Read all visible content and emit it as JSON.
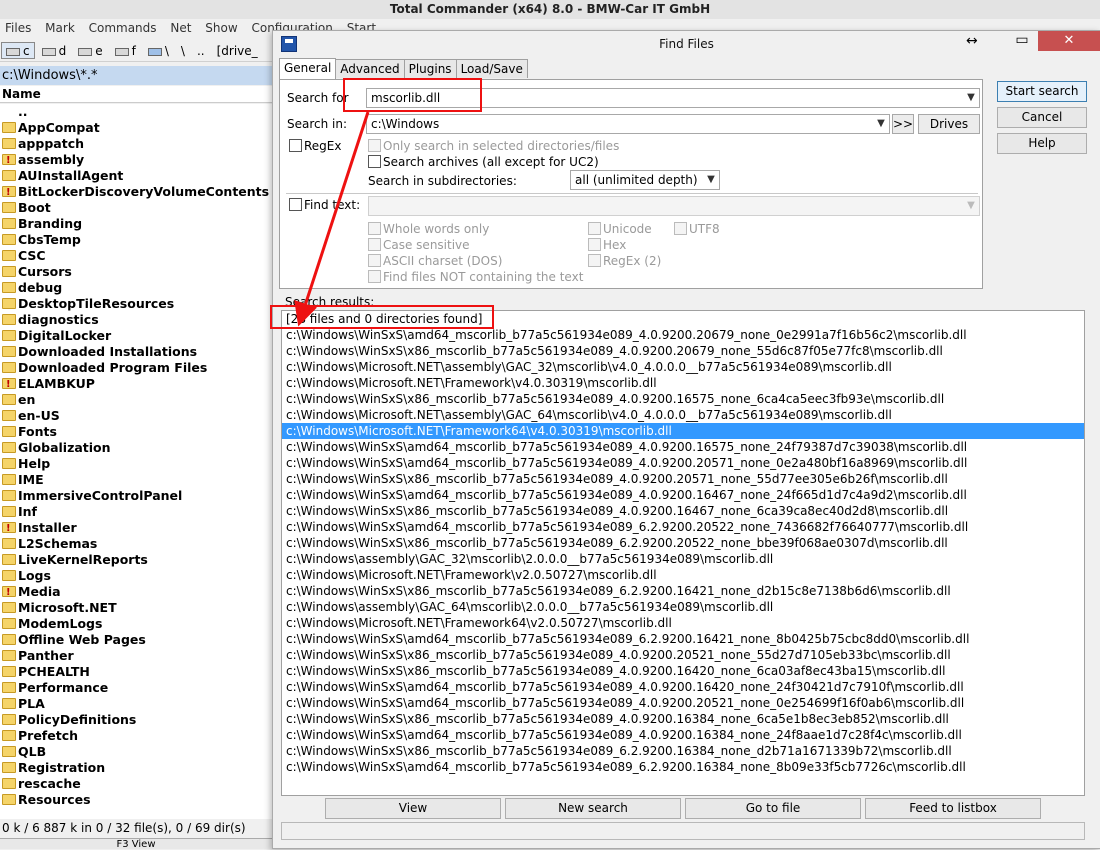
{
  "app": {
    "title": "Total Commander (x64) 8.0 - BMW-Car IT GmbH",
    "menu": [
      "Files",
      "Mark",
      "Commands",
      "Net",
      "Show",
      "Configuration",
      "Start"
    ],
    "drives": [
      "c",
      "d",
      "e",
      "f"
    ],
    "drive_extra": [
      "\\",
      "\\",
      "..",
      "[drive_"
    ],
    "current_path": "c:\\Windows\\*.*",
    "column_name": "Name",
    "files": [
      {
        "name": "..",
        "icon": "parent-dir"
      },
      {
        "name": "AppCompat",
        "icon": "folder-icon"
      },
      {
        "name": "apppatch",
        "icon": "folder-icon"
      },
      {
        "name": "assembly",
        "icon": "folder-warning-icon"
      },
      {
        "name": "AUInstallAgent",
        "icon": "folder-icon"
      },
      {
        "name": "BitLockerDiscoveryVolumeContents",
        "icon": "folder-warning-icon"
      },
      {
        "name": "Boot",
        "icon": "folder-icon"
      },
      {
        "name": "Branding",
        "icon": "folder-icon"
      },
      {
        "name": "CbsTemp",
        "icon": "folder-icon"
      },
      {
        "name": "CSC",
        "icon": "folder-icon"
      },
      {
        "name": "Cursors",
        "icon": "folder-icon"
      },
      {
        "name": "debug",
        "icon": "folder-icon"
      },
      {
        "name": "DesktopTileResources",
        "icon": "folder-icon"
      },
      {
        "name": "diagnostics",
        "icon": "folder-icon"
      },
      {
        "name": "DigitalLocker",
        "icon": "folder-icon"
      },
      {
        "name": "Downloaded Installations",
        "icon": "folder-icon"
      },
      {
        "name": "Downloaded Program Files",
        "icon": "folder-icon"
      },
      {
        "name": "ELAMBKUP",
        "icon": "folder-warning-icon"
      },
      {
        "name": "en",
        "icon": "folder-icon"
      },
      {
        "name": "en-US",
        "icon": "folder-icon"
      },
      {
        "name": "Fonts",
        "icon": "folder-icon"
      },
      {
        "name": "Globalization",
        "icon": "folder-icon"
      },
      {
        "name": "Help",
        "icon": "folder-icon"
      },
      {
        "name": "IME",
        "icon": "folder-icon"
      },
      {
        "name": "ImmersiveControlPanel",
        "icon": "folder-icon"
      },
      {
        "name": "Inf",
        "icon": "folder-icon"
      },
      {
        "name": "Installer",
        "icon": "folder-warning-icon"
      },
      {
        "name": "L2Schemas",
        "icon": "folder-icon"
      },
      {
        "name": "LiveKernelReports",
        "icon": "folder-icon"
      },
      {
        "name": "Logs",
        "icon": "folder-icon"
      },
      {
        "name": "Media",
        "icon": "folder-warning-icon"
      },
      {
        "name": "Microsoft.NET",
        "icon": "folder-icon"
      },
      {
        "name": "ModemLogs",
        "icon": "folder-icon"
      },
      {
        "name": "Offline Web Pages",
        "icon": "folder-icon"
      },
      {
        "name": "Panther",
        "icon": "folder-icon"
      },
      {
        "name": "PCHEALTH",
        "icon": "folder-icon"
      },
      {
        "name": "Performance",
        "icon": "folder-icon"
      },
      {
        "name": "PLA",
        "icon": "folder-icon"
      },
      {
        "name": "PolicyDefinitions",
        "icon": "folder-icon"
      },
      {
        "name": "Prefetch",
        "icon": "folder-icon"
      },
      {
        "name": "QLB",
        "icon": "folder-icon"
      },
      {
        "name": "Registration",
        "icon": "folder-icon"
      },
      {
        "name": "rescache",
        "icon": "folder-icon"
      },
      {
        "name": "Resources",
        "icon": "folder-icon"
      }
    ],
    "status": "0 k / 6 887 k in 0 / 32 file(s), 0 / 69 dir(s)",
    "fkey_label": "F3 View"
  },
  "dialog": {
    "title": "Find Files",
    "resize_glyph": "↔",
    "minimize_glyph": "▭",
    "close_glyph": "✕",
    "tabs": [
      "General",
      "Advanced",
      "Plugins",
      "Load/Save"
    ],
    "search_for_label": "Search for",
    "search_for_value": "mscorlib.dll",
    "search_in_label": "Search in:",
    "search_in_value": "c:\\Windows",
    "browse_label": ">>",
    "drives_label": "Drives",
    "regex_label": "RegEx",
    "only_selected_label": "Only search in selected directories/files",
    "search_archives_label": "Search archives (all except for UC2)",
    "subdirs_label": "Search in subdirectories:",
    "subdirs_value": "all (unlimited depth)",
    "find_text_label": "Find text:",
    "options": {
      "whole_words": "Whole words only",
      "case_sensitive": "Case sensitive",
      "ascii": "ASCII charset (DOS)",
      "not_containing": "Find files NOT containing the text",
      "unicode": "Unicode",
      "utf8": "UTF8",
      "hex": "Hex",
      "regex2": "RegEx (2)"
    },
    "buttons": {
      "start_search": "Start search",
      "cancel": "Cancel",
      "help": "Help"
    },
    "results_label": "Search results:",
    "results_summary": "[28 files and 0 directories found]",
    "selected_index": 6,
    "results": [
      "c:\\Windows\\WinSxS\\amd64_mscorlib_b77a5c561934e089_4.0.9200.20679_none_0e2991a7f16b56c2\\mscorlib.dll",
      "c:\\Windows\\WinSxS\\x86_mscorlib_b77a5c561934e089_4.0.9200.20679_none_55d6c87f05e77fc8\\mscorlib.dll",
      "c:\\Windows\\Microsoft.NET\\assembly\\GAC_32\\mscorlib\\v4.0_4.0.0.0__b77a5c561934e089\\mscorlib.dll",
      "c:\\Windows\\Microsoft.NET\\Framework\\v4.0.30319\\mscorlib.dll",
      "c:\\Windows\\WinSxS\\x86_mscorlib_b77a5c561934e089_4.0.9200.16575_none_6ca4ca5eec3fb93e\\mscorlib.dll",
      "c:\\Windows\\Microsoft.NET\\assembly\\GAC_64\\mscorlib\\v4.0_4.0.0.0__b77a5c561934e089\\mscorlib.dll",
      "c:\\Windows\\Microsoft.NET\\Framework64\\v4.0.30319\\mscorlib.dll",
      "c:\\Windows\\WinSxS\\amd64_mscorlib_b77a5c561934e089_4.0.9200.16575_none_24f79387d7c39038\\mscorlib.dll",
      "c:\\Windows\\WinSxS\\amd64_mscorlib_b77a5c561934e089_4.0.9200.20571_none_0e2a480bf16a8969\\mscorlib.dll",
      "c:\\Windows\\WinSxS\\x86_mscorlib_b77a5c561934e089_4.0.9200.20571_none_55d77ee305e6b26f\\mscorlib.dll",
      "c:\\Windows\\WinSxS\\amd64_mscorlib_b77a5c561934e089_4.0.9200.16467_none_24f665d1d7c4a9d2\\mscorlib.dll",
      "c:\\Windows\\WinSxS\\x86_mscorlib_b77a5c561934e089_4.0.9200.16467_none_6ca39ca8ec40d2d8\\mscorlib.dll",
      "c:\\Windows\\WinSxS\\amd64_mscorlib_b77a5c561934e089_6.2.9200.20522_none_7436682f76640777\\mscorlib.dll",
      "c:\\Windows\\WinSxS\\x86_mscorlib_b77a5c561934e089_6.2.9200.20522_none_bbe39f068ae0307d\\mscorlib.dll",
      "c:\\Windows\\assembly\\GAC_32\\mscorlib\\2.0.0.0__b77a5c561934e089\\mscorlib.dll",
      "c:\\Windows\\Microsoft.NET\\Framework\\v2.0.50727\\mscorlib.dll",
      "c:\\Windows\\WinSxS\\x86_mscorlib_b77a5c561934e089_6.2.9200.16421_none_d2b15c8e7138b6d6\\mscorlib.dll",
      "c:\\Windows\\assembly\\GAC_64\\mscorlib\\2.0.0.0__b77a5c561934e089\\mscorlib.dll",
      "c:\\Windows\\Microsoft.NET\\Framework64\\v2.0.50727\\mscorlib.dll",
      "c:\\Windows\\WinSxS\\amd64_mscorlib_b77a5c561934e089_6.2.9200.16421_none_8b0425b75cbc8dd0\\mscorlib.dll",
      "c:\\Windows\\WinSxS\\x86_mscorlib_b77a5c561934e089_4.0.9200.20521_none_55d27d7105eb33bc\\mscorlib.dll",
      "c:\\Windows\\WinSxS\\x86_mscorlib_b77a5c561934e089_4.0.9200.16420_none_6ca03af8ec43ba15\\mscorlib.dll",
      "c:\\Windows\\WinSxS\\amd64_mscorlib_b77a5c561934e089_4.0.9200.16420_none_24f30421d7c7910f\\mscorlib.dll",
      "c:\\Windows\\WinSxS\\amd64_mscorlib_b77a5c561934e089_4.0.9200.20521_none_0e254699f16f0ab6\\mscorlib.dll",
      "c:\\Windows\\WinSxS\\x86_mscorlib_b77a5c561934e089_4.0.9200.16384_none_6ca5e1b8ec3eb852\\mscorlib.dll",
      "c:\\Windows\\WinSxS\\amd64_mscorlib_b77a5c561934e089_4.0.9200.16384_none_24f8aae1d7c28f4c\\mscorlib.dll",
      "c:\\Windows\\WinSxS\\x86_mscorlib_b77a5c561934e089_6.2.9200.16384_none_d2b71a1671339b72\\mscorlib.dll",
      "c:\\Windows\\WinSxS\\amd64_mscorlib_b77a5c561934e089_6.2.9200.16384_none_8b09e33f5cb7726c\\mscorlib.dll"
    ],
    "bottom_buttons": {
      "view": "View",
      "new_search": "New search",
      "go_to_file": "Go to file",
      "feed_to_listbox": "Feed to listbox"
    }
  },
  "colors": {
    "selection": "#3399ff",
    "annotation_red": "#ee1111",
    "path_bar": "#c5d9f0",
    "folder": "#f5d469"
  }
}
